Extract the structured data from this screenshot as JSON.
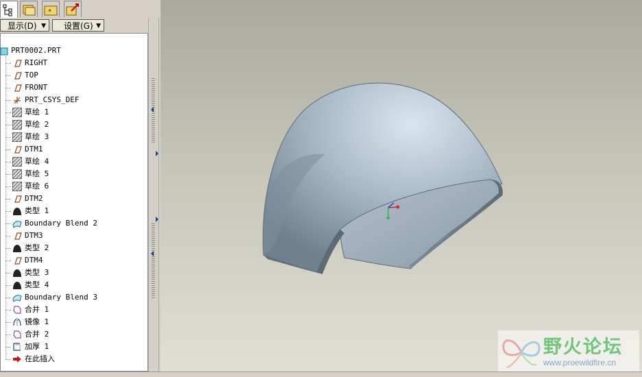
{
  "tabs": [
    {
      "icon": "model-tree-icon",
      "active": true
    },
    {
      "icon": "folder-browser-icon",
      "active": false
    },
    {
      "icon": "favorites-icon",
      "active": false
    },
    {
      "icon": "connections-icon",
      "active": false
    }
  ],
  "toolbar": {
    "display_label": "显示(D)",
    "settings_label": "设置(G)"
  },
  "tree": {
    "root": "PRT0002.PRT",
    "items": [
      {
        "label": "RIGHT",
        "icon": "datum-plane-icon"
      },
      {
        "label": "TOP",
        "icon": "datum-plane-icon"
      },
      {
        "label": "FRONT",
        "icon": "datum-plane-icon"
      },
      {
        "label": "PRT_CSYS_DEF",
        "icon": "coordinate-system-icon"
      },
      {
        "label": "草绘 1",
        "icon": "sketch-icon"
      },
      {
        "label": "草绘 2",
        "icon": "sketch-icon"
      },
      {
        "label": "草绘 3",
        "icon": "sketch-icon"
      },
      {
        "label": "DTM1",
        "icon": "datum-plane-icon"
      },
      {
        "label": "草绘 4",
        "icon": "sketch-icon"
      },
      {
        "label": "草绘 5",
        "icon": "sketch-icon"
      },
      {
        "label": "草绘 6",
        "icon": "sketch-icon"
      },
      {
        "label": "DTM2",
        "icon": "datum-plane-icon"
      },
      {
        "label": "类型 1",
        "icon": "style-feature-icon"
      },
      {
        "label": "Boundary Blend 2",
        "icon": "boundary-blend-icon"
      },
      {
        "label": "DTM3",
        "icon": "datum-plane-icon"
      },
      {
        "label": "类型 2",
        "icon": "style-feature-icon"
      },
      {
        "label": "DTM4",
        "icon": "datum-plane-icon"
      },
      {
        "label": "类型 3",
        "icon": "style-feature-icon"
      },
      {
        "label": "类型 4",
        "icon": "style-feature-icon"
      },
      {
        "label": "Boundary Blend 3",
        "icon": "boundary-blend-icon"
      },
      {
        "label": "合并 1",
        "icon": "merge-icon"
      },
      {
        "label": "镜像 1",
        "icon": "mirror-icon"
      },
      {
        "label": "合并 2",
        "icon": "merge-icon"
      },
      {
        "label": "加厚 1",
        "icon": "thicken-icon"
      },
      {
        "label": "在此插入",
        "icon": "insert-here-icon"
      }
    ]
  },
  "watermark": {
    "title": "野火论坛",
    "url": "www.proewildfire.cn"
  },
  "colors": {
    "model": "#b9c8d6",
    "viewport_top": "#a9a99e",
    "viewport_bottom": "#e1dfd5"
  }
}
